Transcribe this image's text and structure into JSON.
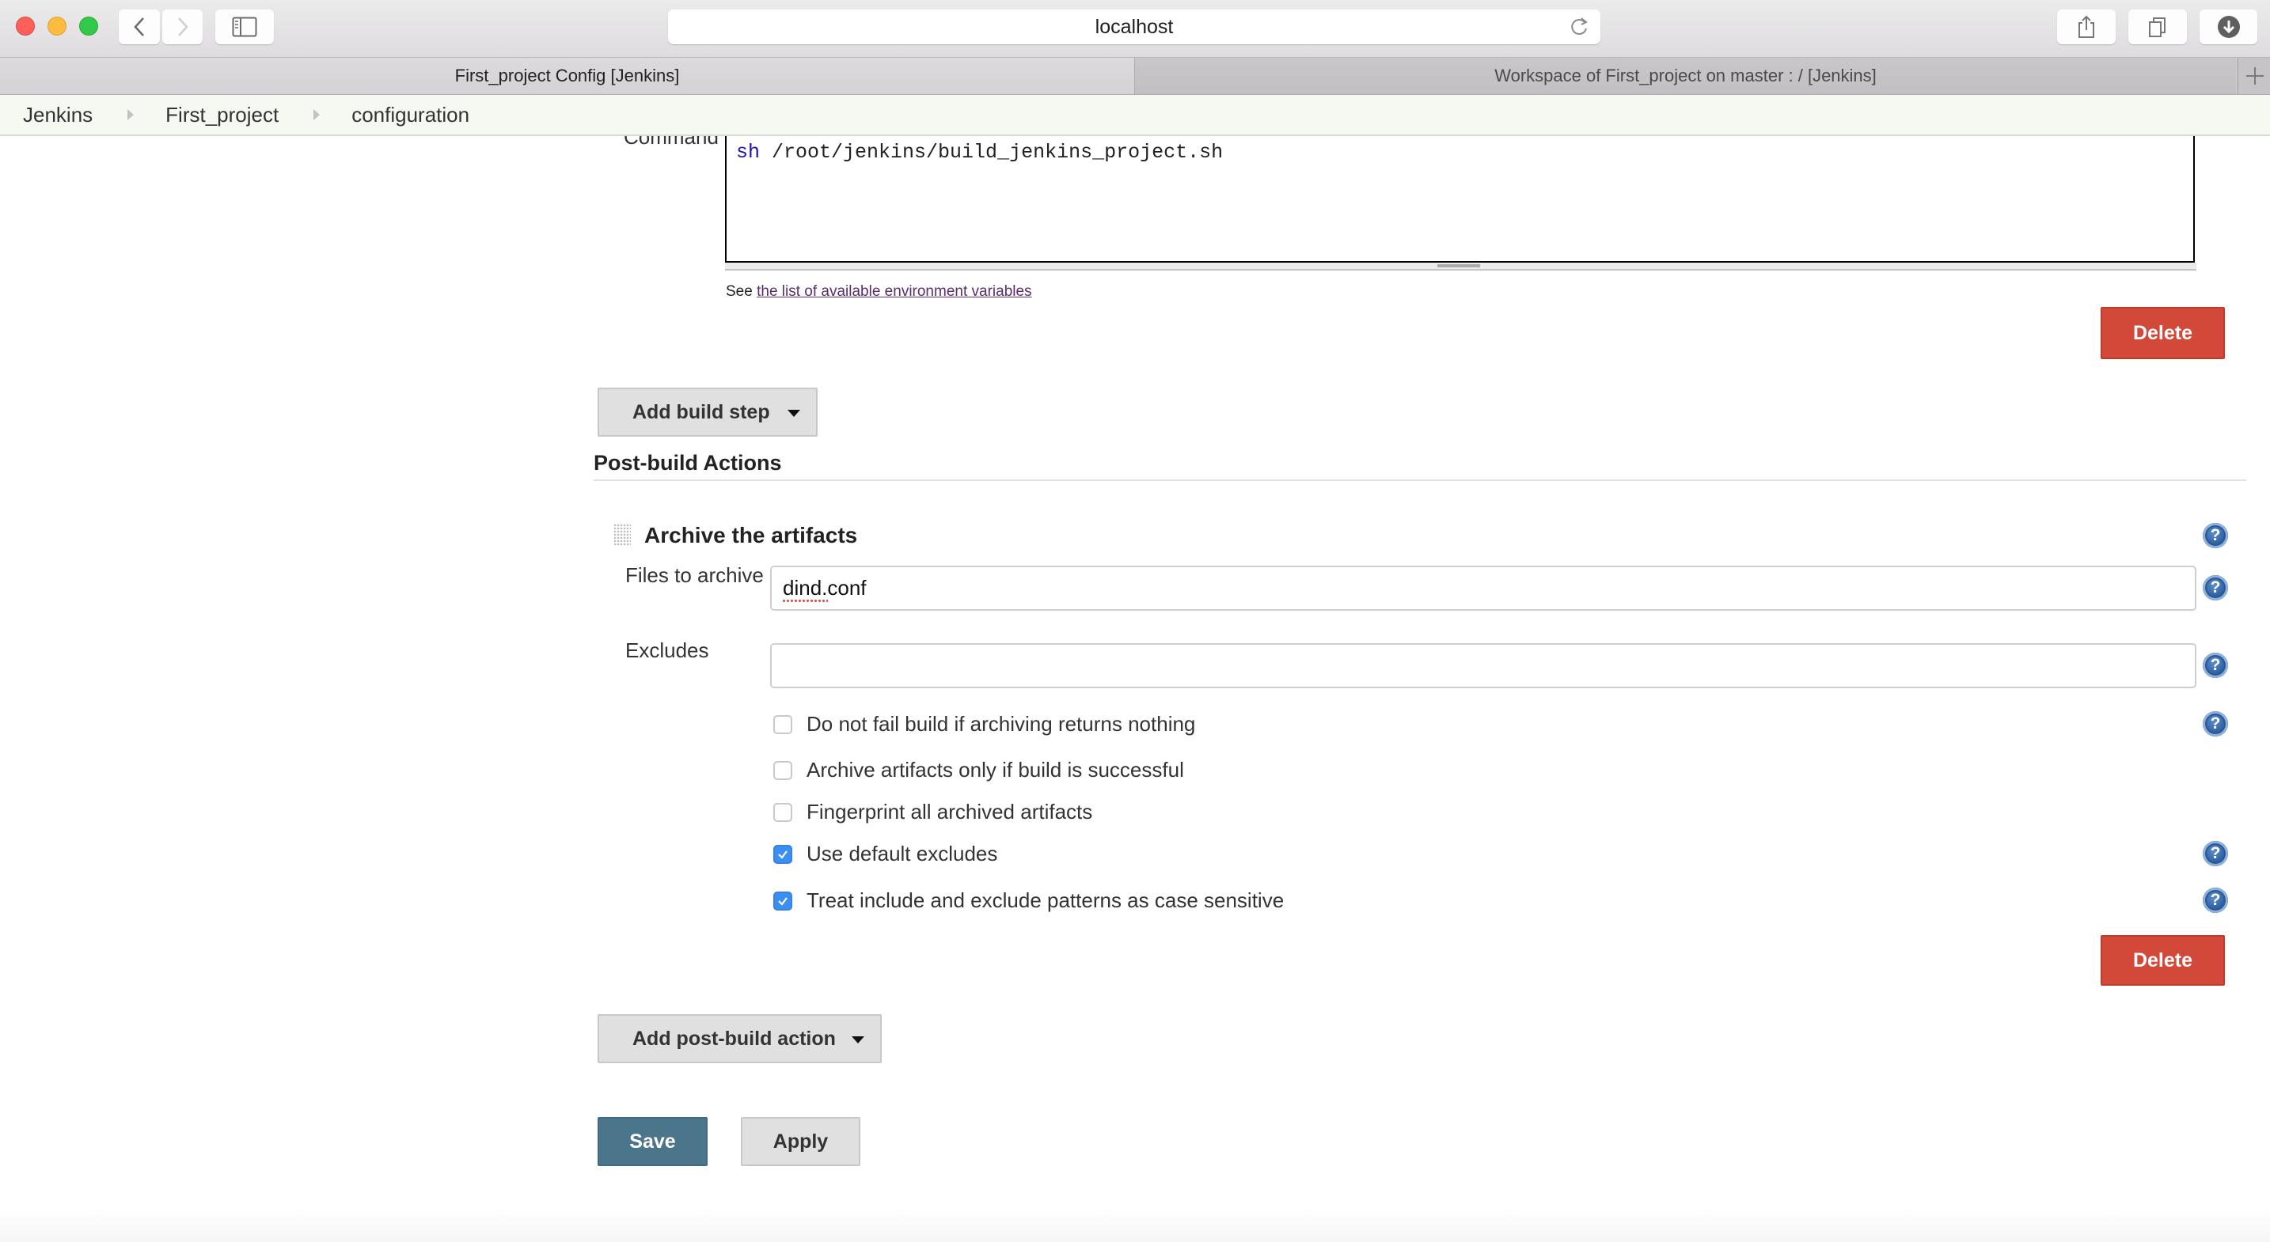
{
  "browser": {
    "url": "localhost",
    "tabs": [
      {
        "title": "First_project Config [Jenkins]",
        "active": true
      },
      {
        "title": "Workspace of First_project on master : / [Jenkins]",
        "active": false
      }
    ],
    "icons": {
      "back": "chevron-left-icon",
      "forward": "chevron-right-icon",
      "sidebar": "sidebar-icon",
      "reload": "reload-icon",
      "share": "share-icon",
      "tabs": "tabs-overview-icon",
      "downloads": "download-icon",
      "new_tab": "plus-icon"
    }
  },
  "breadcrumb": [
    "Jenkins",
    "First_project",
    "configuration"
  ],
  "build_step": {
    "command_label": "Command",
    "command_keyword": "sh",
    "command_rest": " /root/jenkins/build_jenkins_project.sh",
    "see_prefix": "See ",
    "env_link": "the list of available environment variables",
    "delete_label": "Delete"
  },
  "add_build_step_label": "Add build step",
  "post_build": {
    "heading": "Post-build Actions",
    "archive": {
      "title": "Archive the artifacts",
      "files_label": "Files to archive",
      "files_value": "dind.conf",
      "excludes_label": "Excludes",
      "excludes_value": "",
      "options": [
        {
          "label": "Do not fail build if archiving returns nothing",
          "checked": false,
          "help": true
        },
        {
          "label": "Archive artifacts only if build is successful",
          "checked": false,
          "help": false
        },
        {
          "label": "Fingerprint all archived artifacts",
          "checked": false,
          "help": false
        },
        {
          "label": "Use default excludes",
          "checked": true,
          "help": true
        },
        {
          "label": "Treat include and exclude patterns as case sensitive",
          "checked": true,
          "help": true
        }
      ],
      "delete_label": "Delete"
    },
    "add_label": "Add post-build action"
  },
  "actions": {
    "save_label": "Save",
    "apply_label": "Apply"
  },
  "help_glyph": "?",
  "colors": {
    "delete": "#d24939",
    "save": "#4b758b",
    "checkbox_checked": "#3b8ef2",
    "link": "#5a2e6e"
  }
}
